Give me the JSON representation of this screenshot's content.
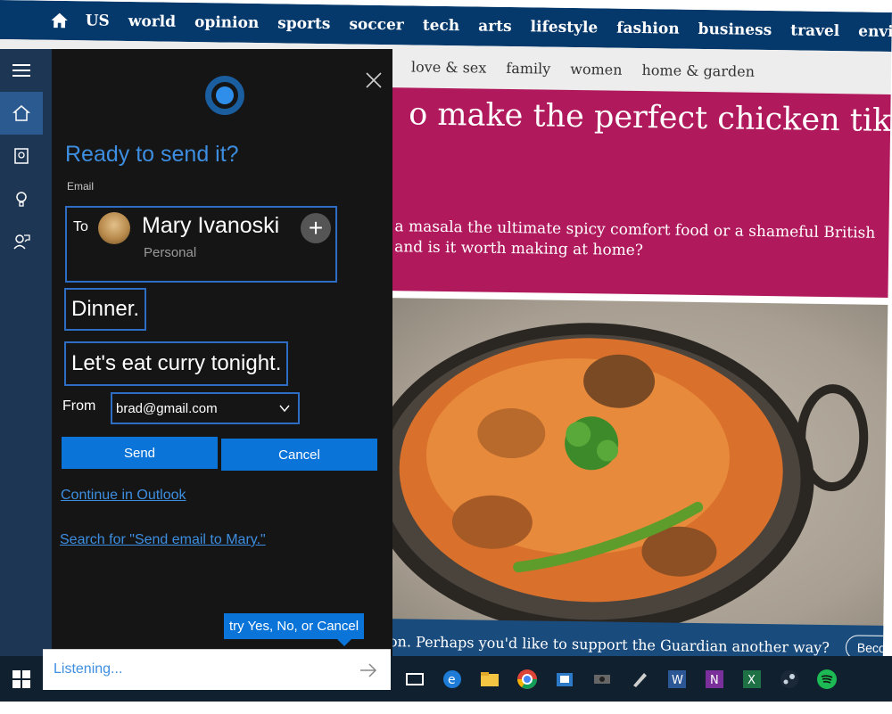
{
  "guardian": {
    "nav": [
      "US",
      "world",
      "opinion",
      "sports",
      "soccer",
      "tech",
      "arts",
      "lifestyle",
      "fashion",
      "business",
      "travel",
      "environment"
    ],
    "subnav": [
      "love & sex",
      "family",
      "women",
      "home & garden"
    ],
    "headline": "o make the perfect chicken tikka",
    "standfirst_line1": "a masala the ultimate spicy comfort food or a shameful British",
    "standfirst_line2": "and is it worth making at home?",
    "support_text": "on. Perhaps you'd like to support the Guardian another way?",
    "become_label": "Become"
  },
  "cortana": {
    "title": "Ready to send it?",
    "email_label": "Email",
    "to_label": "To",
    "contact_name": "Mary Ivanoski",
    "contact_type": "Personal",
    "add_symbol": "+",
    "subject": "Dinner.",
    "message": "Let's eat curry tonight.",
    "from_label": "From",
    "from_value": "brad@gmail.com",
    "send_label": "Send",
    "cancel_label": "Cancel",
    "continue_link": "Continue in Outlook",
    "search_link": "Search for \"Send email to Mary.\"",
    "hint": "try Yes, No, or Cancel",
    "listening": "Listening..."
  },
  "colors": {
    "guardian_nav": "#05386b",
    "hero_magenta": "#b0195c",
    "cortana_blue": "#0a74d9",
    "panel_bg": "#151515",
    "taskbar": "#10202e"
  },
  "icons": {
    "sidebar": [
      "hamburger-icon",
      "home-icon",
      "notebook-icon",
      "lightbulb-icon",
      "feedback-icon"
    ],
    "taskbar": [
      "task-view-icon",
      "edge-icon",
      "file-explorer-icon",
      "chrome-icon",
      "store-icon",
      "app-icon",
      "pen-icon",
      "word-icon",
      "onenote-icon",
      "excel-icon",
      "steam-icon",
      "spotify-icon"
    ]
  }
}
